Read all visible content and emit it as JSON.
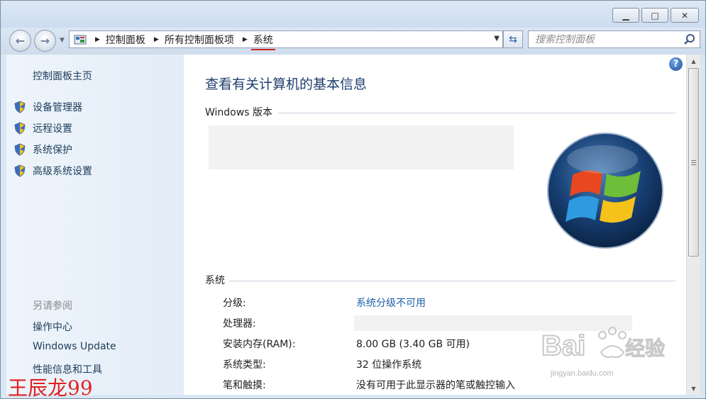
{
  "window": {
    "controls": {
      "minimize": "▁",
      "maximize": "□",
      "close": "✕"
    }
  },
  "address": {
    "crumbs": [
      "控制面板",
      "所有控制面板项",
      "系统"
    ]
  },
  "search": {
    "placeholder": "搜索控制面板"
  },
  "sidebar": {
    "home": "控制面板主页",
    "tasks": [
      "设备管理器",
      "远程设置",
      "系统保护",
      "高级系统设置"
    ],
    "see_also_title": "另请参阅",
    "see_also": [
      "操作中心",
      "Windows Update",
      "性能信息和工具"
    ]
  },
  "main": {
    "title": "查看有关计算机的基本信息",
    "edition_section": "Windows 版本",
    "system_section": "系统",
    "properties": [
      {
        "label": "分级:",
        "value": "系统分级不可用"
      },
      {
        "label": "处理器:",
        "value": ""
      },
      {
        "label": "安装内存(RAM):",
        "value": "8.00 GB (3.40 GB 可用)"
      },
      {
        "label": "系统类型:",
        "value": "32 位操作系统"
      },
      {
        "label": "笔和触摸:",
        "value": "没有可用于此显示器的笔或触控输入"
      }
    ]
  },
  "overlays": {
    "watermark_url": "jingyan.baidu.com",
    "author": "王辰龙99"
  },
  "colors": {
    "link": "#1c5fa7",
    "title": "#1e3e6e",
    "author_red": "#e02222",
    "breadcrumb_underline": "#d32020"
  }
}
